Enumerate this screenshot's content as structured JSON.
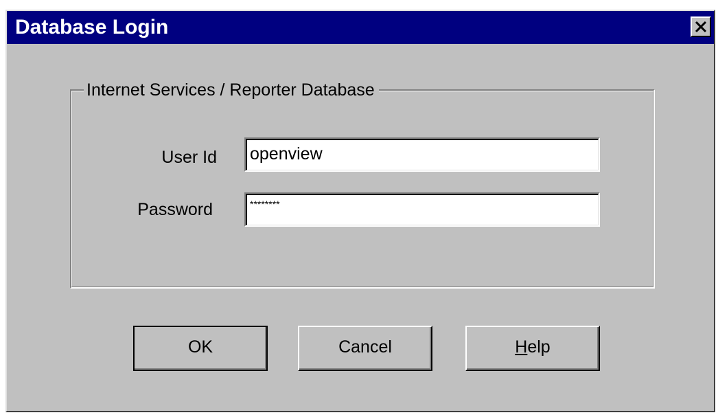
{
  "window": {
    "title": "Database Login"
  },
  "titlebar": {
    "close_icon": "close-icon"
  },
  "group": {
    "legend": "Internet Services / Reporter Database"
  },
  "fields": {
    "user_id_label": "User Id",
    "user_id_value": "openview",
    "password_label": "Password",
    "password_value": "********"
  },
  "buttons": {
    "ok_label": "OK",
    "cancel_label": "Cancel",
    "help_accel": "H",
    "help_rest": "elp"
  },
  "colors": {
    "titlebar": "#000080",
    "dialog_face": "#c0c0c0"
  }
}
